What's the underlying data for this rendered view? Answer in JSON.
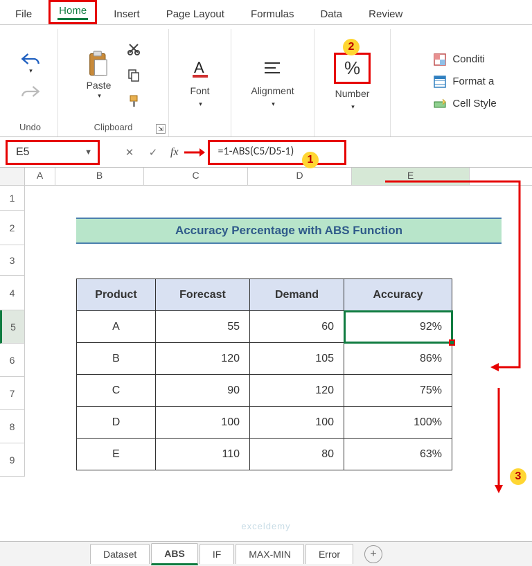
{
  "menu": {
    "file": "File",
    "home": "Home",
    "insert": "Insert",
    "page_layout": "Page Layout",
    "formulas": "Formulas",
    "data": "Data",
    "review": "Review"
  },
  "ribbon": {
    "undo_group": "Undo",
    "clipboard_group": "Clipboard",
    "paste": "Paste",
    "font_group": "Font",
    "alignment_group": "Alignment",
    "number_group": "Number",
    "percent_symbol": "%",
    "conditional": "Conditi",
    "format_as": "Format a",
    "cell_styles": "Cell Style"
  },
  "callouts": {
    "one": "1",
    "two": "2",
    "three": "3"
  },
  "formula_bar": {
    "cell_ref": "E5",
    "formula": "=1-ABS(C5/D5-1)"
  },
  "columns": {
    "A": "A",
    "B": "B",
    "C": "C",
    "D": "D",
    "E": "E"
  },
  "row_labels": [
    "1",
    "2",
    "3",
    "4",
    "5",
    "6",
    "7",
    "8",
    "9"
  ],
  "title": "Accuracy Percentage with ABS Function",
  "headers": {
    "product": "Product",
    "forecast": "Forecast",
    "demand": "Demand",
    "accuracy": "Accuracy"
  },
  "rows": [
    {
      "p": "A",
      "f": "55",
      "d": "60",
      "a": "92%"
    },
    {
      "p": "B",
      "f": "120",
      "d": "105",
      "a": "86%"
    },
    {
      "p": "C",
      "f": "90",
      "d": "120",
      "a": "75%"
    },
    {
      "p": "D",
      "f": "100",
      "d": "100",
      "a": "100%"
    },
    {
      "p": "E",
      "f": "110",
      "d": "80",
      "a": "63%"
    }
  ],
  "sheets": {
    "dataset": "Dataset",
    "abs": "ABS",
    "if": "IF",
    "maxmin": "MAX-MIN",
    "error": "Error"
  },
  "watermark": "exceldemy"
}
